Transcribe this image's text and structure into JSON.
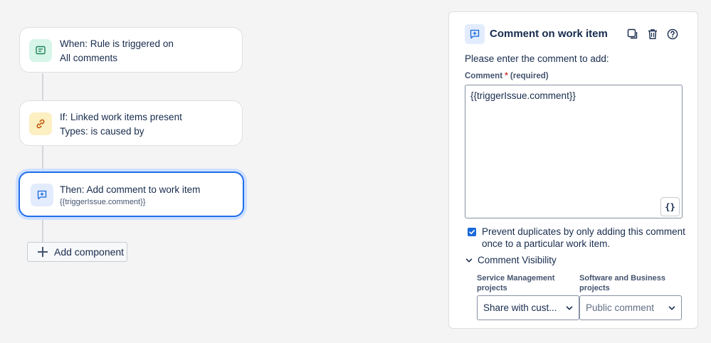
{
  "flow": {
    "trigger": {
      "line1": "When: Rule is triggered on",
      "line2": "All comments",
      "icon": "comment-icon",
      "color": "#d7f5e9"
    },
    "condition": {
      "line1": "If: Linked work items present",
      "line2": "Types: is caused by",
      "icon": "link-icon",
      "color": "#fcefc2"
    },
    "action": {
      "line1": "Then: Add comment to work item",
      "line2": "{{triggerIssue.comment}}",
      "icon": "add-comment-icon",
      "color": "#e2ecfd"
    },
    "add_component_label": "Add component"
  },
  "panel": {
    "title": "Comment on work item",
    "prompt": "Please enter the comment to add:",
    "comment_label": "Comment",
    "required_star": "*",
    "required_text": "(required)",
    "comment_value": "{{triggerIssue.comment}}",
    "smart_values_button": "{}",
    "prevent_duplicates_checked": true,
    "prevent_duplicates_label": "Prevent duplicates by only adding this comment once to a particular work item.",
    "visibility_label": "Comment Visibility",
    "service_mgmt_label": "Service Management projects",
    "service_mgmt_value": "Share with cust...",
    "software_label": "Software and Business projects",
    "software_value": "Public comment",
    "accent": "#1868db"
  }
}
